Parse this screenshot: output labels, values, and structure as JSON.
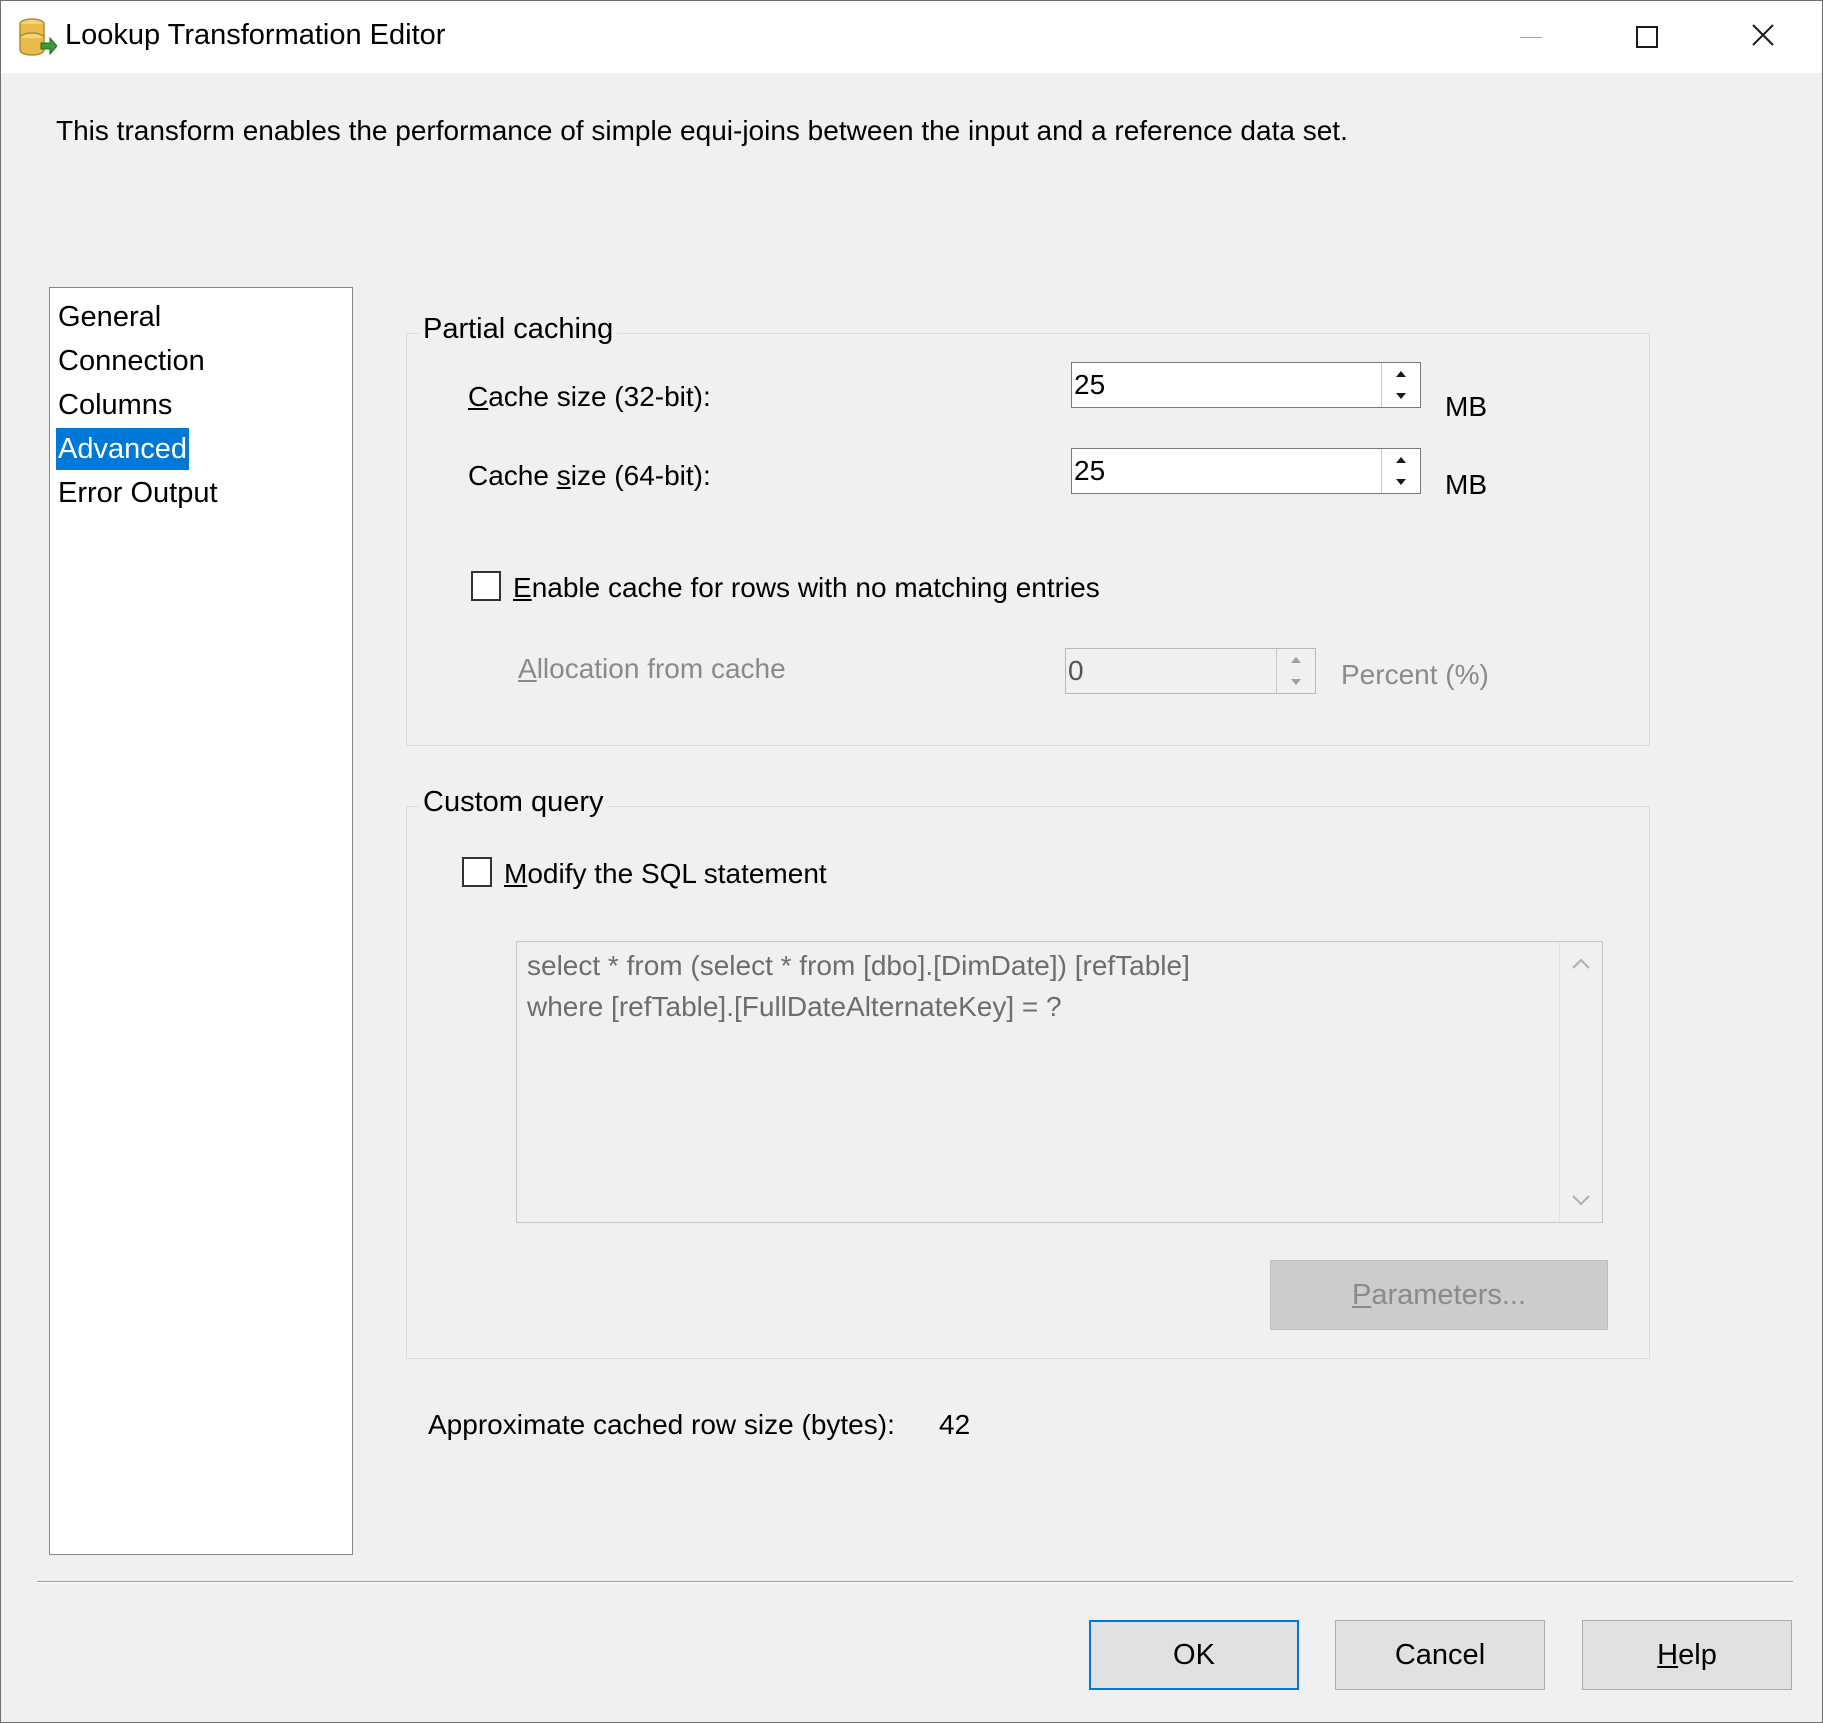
{
  "window": {
    "title": "Lookup Transformation Editor",
    "icon": "database-lookup-icon",
    "controls": {
      "minimize": "minimize-icon",
      "maximize": "maximize-icon",
      "close": "close-icon"
    }
  },
  "description": "This transform enables the performance of simple equi-joins between the input and a reference data set.",
  "nav": {
    "items": [
      {
        "label": "General",
        "selected": false
      },
      {
        "label": "Connection",
        "selected": false
      },
      {
        "label": "Columns",
        "selected": false
      },
      {
        "label": "Advanced",
        "selected": true
      },
      {
        "label": "Error Output",
        "selected": false
      }
    ]
  },
  "partial_caching": {
    "title": "Partial caching",
    "cache32": {
      "label_key": "C",
      "label_rest": "ache size (32-bit):",
      "value": "25",
      "unit": "MB"
    },
    "cache64": {
      "label_pre": "Cache ",
      "label_key": "s",
      "label_rest": "ize (64-bit):",
      "value": "25",
      "unit": "MB"
    },
    "enable_cache": {
      "label_key": "E",
      "label_rest": "nable cache for rows with no matching entries",
      "checked": false
    },
    "allocation": {
      "label_key": "A",
      "label_rest": "llocation from cache",
      "value": "0",
      "unit": "Percent (%)"
    }
  },
  "custom_query": {
    "title": "Custom query",
    "modify_sql": {
      "label_key": "M",
      "label_rest": "odify the SQL statement",
      "checked": false
    },
    "sql_lines": [
      "select * from (select * from [dbo].[DimDate]) [refTable]",
      "where [refTable].[FullDateAlternateKey] = ?"
    ],
    "parameters_button": {
      "label_key": "P",
      "label_rest": "arameters..."
    }
  },
  "row_size": {
    "label": "Approximate cached row size (bytes):",
    "value": "42"
  },
  "footer": {
    "ok": "OK",
    "cancel": "Cancel",
    "help_key": "H",
    "help_rest": "elp"
  }
}
